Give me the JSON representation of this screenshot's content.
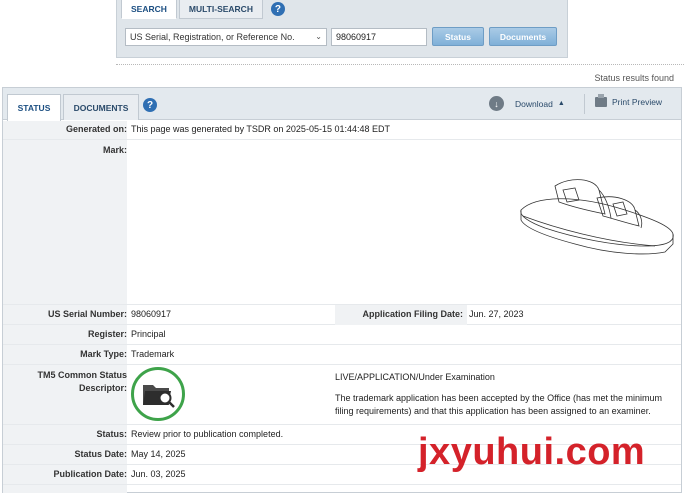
{
  "search": {
    "tabs": [
      "SEARCH",
      "MULTI-SEARCH"
    ],
    "help_label": "?",
    "type_selected": "US Serial, Registration, or Reference No.",
    "serial_value": "98060917",
    "status_button": "Status",
    "documents_button": "Documents"
  },
  "results_found": "Status results found",
  "main": {
    "tabs": [
      "STATUS",
      "DOCUMENTS"
    ],
    "help_label": "?",
    "download_label": "Download",
    "print_label": "Print Preview"
  },
  "details": {
    "generated_on": {
      "label": "Generated on:",
      "value": "This page was generated by TSDR on 2025-05-15 01:44:48 EDT"
    },
    "mark": {
      "label": "Mark:"
    },
    "serial_number": {
      "label": "US Serial Number:",
      "value": "98060917"
    },
    "filing_date": {
      "label": "Application Filing Date:",
      "value": "Jun. 27, 2023"
    },
    "register": {
      "label": "Register:",
      "value": "Principal"
    },
    "mark_type": {
      "label": "Mark Type:",
      "value": "Trademark"
    },
    "tm5": {
      "label_line1": "TM5 Common Status",
      "label_line2": "Descriptor:",
      "status": "LIVE/APPLICATION/Under Examination",
      "description": "The trademark application has been accepted by the Office (has met the minimum filing requirements) and that this application has been assigned to an examiner."
    },
    "status": {
      "label": "Status:",
      "value": "Review prior to publication completed."
    },
    "status_date": {
      "label": "Status Date:",
      "value": "May 14, 2025"
    },
    "publication_date": {
      "label": "Publication Date:",
      "value": "Jun. 03, 2025"
    }
  },
  "watermark": "jxyuhui.com",
  "colors": {
    "accent": "#1c4f82",
    "button": "#7fb0d8",
    "tm5_ring": "#3ea34a",
    "watermark": "#d4222a"
  }
}
